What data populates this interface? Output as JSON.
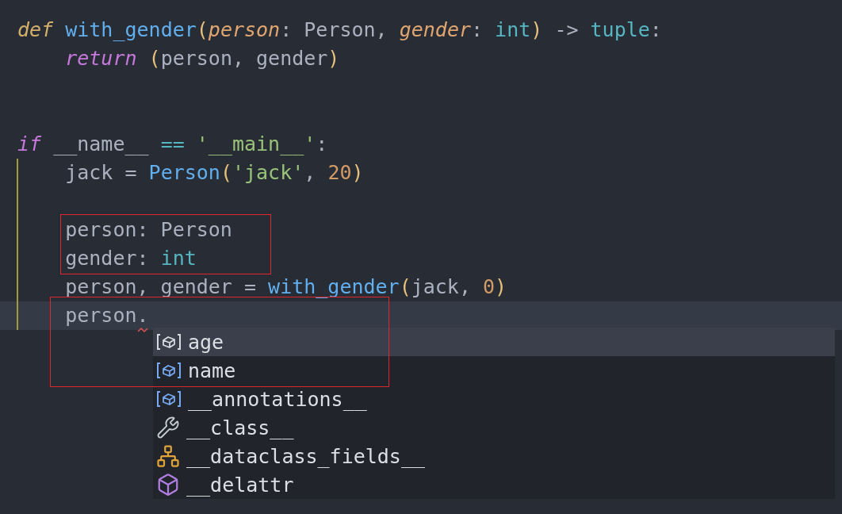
{
  "editor": {
    "lines": [
      {
        "current": false,
        "tokens": [
          {
            "text": "def ",
            "kind": "keyword_def"
          },
          {
            "text": "with_gender",
            "kind": "function"
          },
          {
            "text": "(",
            "kind": "paren"
          },
          {
            "text": "person",
            "kind": "param"
          },
          {
            "text": ": Person, ",
            "kind": "plain"
          },
          {
            "text": "gender",
            "kind": "param"
          },
          {
            "text": ": ",
            "kind": "plain"
          },
          {
            "text": "int",
            "kind": "type"
          },
          {
            "text": ")",
            "kind": "paren"
          },
          {
            "text": " -> ",
            "kind": "plain"
          },
          {
            "text": "tuple",
            "kind": "type"
          },
          {
            "text": ":",
            "kind": "plain"
          }
        ]
      },
      {
        "current": false,
        "tokens": [
          {
            "text": "    return ",
            "kind": "keyword"
          },
          {
            "text": "(",
            "kind": "paren"
          },
          {
            "text": "person, gender",
            "kind": "plain"
          },
          {
            "text": ")",
            "kind": "paren"
          }
        ]
      },
      {
        "current": false
      },
      {
        "current": false
      },
      {
        "current": false,
        "tokens": [
          {
            "text": "if",
            "kind": "keyword"
          },
          {
            "text": " __name__ ",
            "kind": "plain"
          },
          {
            "text": "==",
            "kind": "operator"
          },
          {
            "text": " '__main__'",
            "kind": "string"
          },
          {
            "text": ":",
            "kind": "plain"
          }
        ]
      },
      {
        "current": false,
        "tokens": [
          {
            "text": "    jack = ",
            "kind": "plain"
          },
          {
            "text": "Person",
            "kind": "function"
          },
          {
            "text": "(",
            "kind": "paren"
          },
          {
            "text": "'jack'",
            "kind": "string"
          },
          {
            "text": ", ",
            "kind": "plain"
          },
          {
            "text": "20",
            "kind": "number"
          },
          {
            "text": ")",
            "kind": "paren"
          }
        ]
      },
      {
        "current": false
      },
      {
        "current": false,
        "tokens": [
          {
            "text": "    person: Person",
            "kind": "plain"
          }
        ]
      },
      {
        "current": false,
        "tokens": [
          {
            "text": "    gender: ",
            "kind": "plain"
          },
          {
            "text": "int",
            "kind": "type"
          }
        ]
      },
      {
        "current": false,
        "tokens": [
          {
            "text": "    person, gender = ",
            "kind": "plain"
          },
          {
            "text": "with_gender",
            "kind": "function"
          },
          {
            "text": "(",
            "kind": "paren"
          },
          {
            "text": "jack, ",
            "kind": "plain"
          },
          {
            "text": "0",
            "kind": "number"
          },
          {
            "text": ")",
            "kind": "paren"
          }
        ]
      },
      {
        "current": true,
        "tokens": [
          {
            "text": "    person.",
            "kind": "plain"
          }
        ]
      }
    ]
  },
  "suggestions": [
    {
      "label": "age",
      "kind": "field",
      "selected": true
    },
    {
      "label": "name",
      "kind": "field",
      "selected": false
    },
    {
      "label": "__annotations__",
      "kind": "field",
      "selected": false
    },
    {
      "label": "__class__",
      "kind": "method",
      "selected": false
    },
    {
      "label": "__dataclass_fields__",
      "kind": "struct",
      "selected": false
    },
    {
      "label": "__delattr",
      "kind": "object",
      "selected": false
    }
  ]
}
